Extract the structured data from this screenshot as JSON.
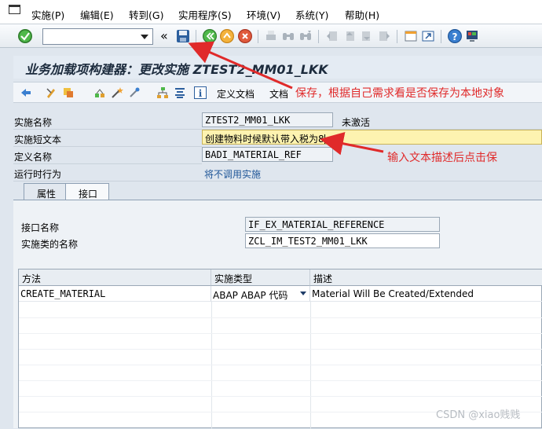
{
  "menu": {
    "items": [
      "实施(P)",
      "编辑(E)",
      "转到(G)",
      "实用程序(S)",
      "环境(V)",
      "系统(Y)",
      "帮助(H)"
    ]
  },
  "toolbar": {
    "command_value": "",
    "back_glyph": "«",
    "icons": [
      "check-icon",
      "save-icon",
      "back-icon",
      "exit-icon",
      "cancel-icon",
      "print-icon",
      "find-icon",
      "find-next-icon",
      "first-page-icon",
      "previous-page-icon",
      "next-page-icon",
      "last-page-icon",
      "new-session-icon",
      "shortcut-icon",
      "help-icon",
      "customize-layout-icon"
    ]
  },
  "title": "业务加载项构建器：更改实施 ZTEST2_MM01_LKK",
  "app_toolbar": {
    "define_doc_label": "定义文档",
    "doc_label": "文档"
  },
  "form": {
    "impl_name_label": "实施名称",
    "impl_name_value": "ZTEST2_MM01_LKK",
    "status_text": "未激活",
    "short_text_label": "实施短文本",
    "short_text_value": "创建物料时候默认带入税为8",
    "def_name_label": "定义名称",
    "def_name_value": "BADI_MATERIAL_REF",
    "runtime_label": "运行时行为",
    "runtime_value": "将不调用实施"
  },
  "tabs": [
    {
      "label": "属性"
    },
    {
      "label": "接口"
    }
  ],
  "interface": {
    "interface_name_label": "接口名称",
    "interface_name_value": "IF_EX_MATERIAL_REFERENCE",
    "impl_class_label": "实施类的名称",
    "impl_class_value": "ZCL_IM_TEST2_MM01_LKK"
  },
  "table": {
    "headers": [
      "方法",
      "实施类型",
      "描述"
    ],
    "rows": [
      {
        "method": "CREATE_MATERIAL",
        "impl_type": "ABAP ABAP 代码",
        "description": "Material Will Be Created/Extended"
      }
    ]
  },
  "annotations": {
    "save_note": "保存，根据自己需求看是否保存为本地对象",
    "input_note": "输入文本描述后点击保"
  },
  "watermark": "CSDN @xiao贱贱",
  "colors": {
    "annotation_red": "#e02a2a",
    "header_bg": "#e4ebf3",
    "short_text_highlight": "#fdf3b0"
  }
}
